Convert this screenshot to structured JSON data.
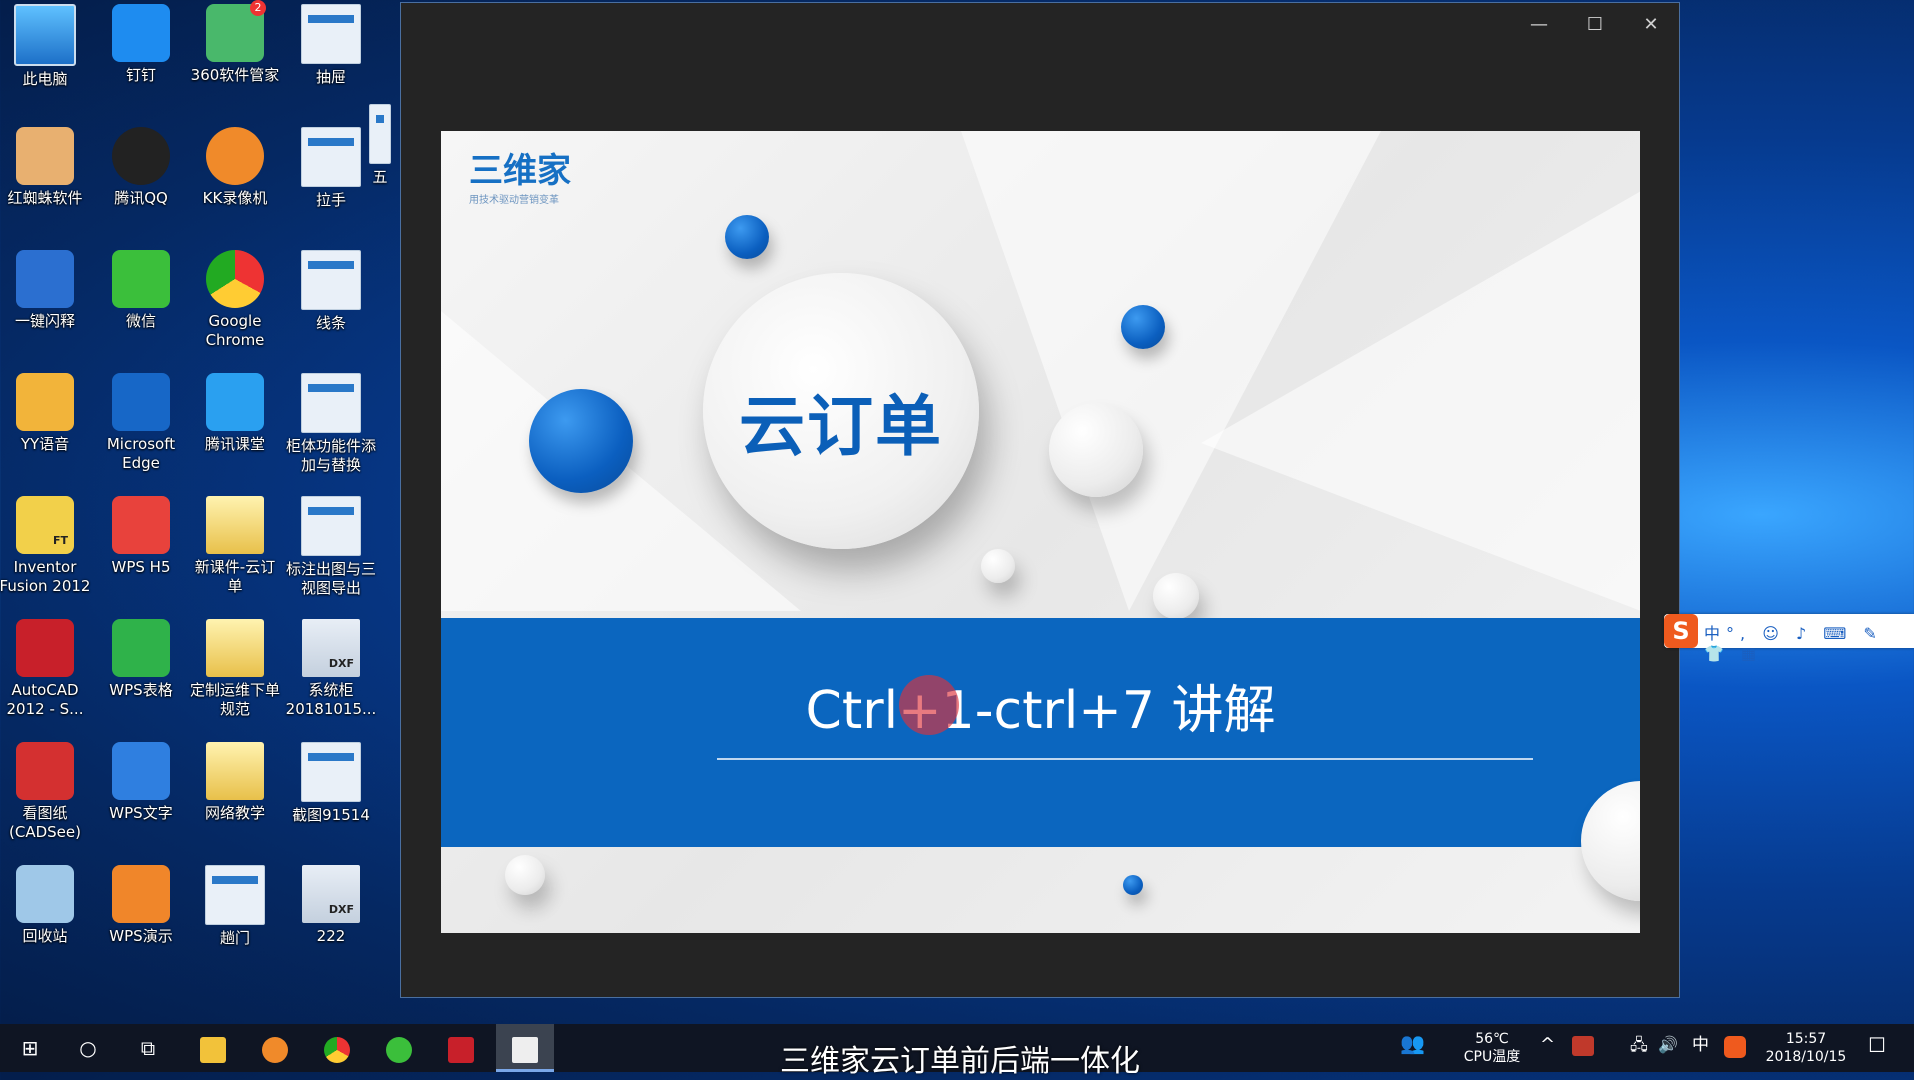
{
  "desktop": {
    "icons": [
      {
        "label": "此电脑",
        "icon": "computer-icon"
      },
      {
        "label": "钉钉",
        "icon": "dingtalk-icon"
      },
      {
        "label": "360软件管家",
        "icon": "360-software-icon",
        "badge": "2"
      },
      {
        "label": "抽屉",
        "icon": "thumbnail-icon"
      },
      {
        "label": "红蜘蛛软件",
        "icon": "red-spider-icon"
      },
      {
        "label": "腾讯QQ",
        "icon": "qq-penguin-icon"
      },
      {
        "label": "KK录像机",
        "icon": "kk-recorder-icon"
      },
      {
        "label": "拉手",
        "icon": "thumbnail-icon"
      },
      {
        "label": "一键闪释",
        "icon": "lightning-icon"
      },
      {
        "label": "微信",
        "icon": "wechat-icon"
      },
      {
        "label": "Google Chrome",
        "icon": "chrome-icon"
      },
      {
        "label": "线条",
        "icon": "thumbnail-icon"
      },
      {
        "label": "YY语音",
        "icon": "yy-raccoon-icon"
      },
      {
        "label": "Microsoft Edge",
        "icon": "edge-icon"
      },
      {
        "label": "腾讯课堂",
        "icon": "tencent-classroom-icon"
      },
      {
        "label": "柜体功能件添加与替换",
        "icon": "thumbnail-icon"
      },
      {
        "label": "Inventor Fusion 2012",
        "icon": "inventor-icon"
      },
      {
        "label": "WPS H5",
        "icon": "wps-h5-icon"
      },
      {
        "label": "新课件-云订单",
        "icon": "folder-icon"
      },
      {
        "label": "标注出图与三视图导出",
        "icon": "thumbnail-icon"
      },
      {
        "label": "AutoCAD 2012 - S...",
        "icon": "autocad-icon"
      },
      {
        "label": "WPS表格",
        "icon": "wps-sheet-icon"
      },
      {
        "label": "定制运维下单规范",
        "icon": "folder-icon"
      },
      {
        "label": "系统柜 20181015...",
        "icon": "dxf-file-icon"
      },
      {
        "label": "看图纸 (CADSee)",
        "icon": "cadsee-icon"
      },
      {
        "label": "WPS文字",
        "icon": "wps-writer-icon"
      },
      {
        "label": "网络教学",
        "icon": "folder-icon"
      },
      {
        "label": "截图91514",
        "icon": "thumbnail-icon"
      },
      {
        "label": "回收站",
        "icon": "recycle-bin-icon"
      },
      {
        "label": "WPS演示",
        "icon": "wps-presentation-icon"
      },
      {
        "label": "趟门",
        "icon": "thumbnail-icon"
      },
      {
        "label": "222",
        "icon": "dxf-file-icon"
      }
    ],
    "partial_label": "五",
    "dxf_tag": "DXF",
    "ft_tag": "FT"
  },
  "viewer": {
    "controls": {
      "minimize": "—",
      "maximize": "☐",
      "close": "✕"
    },
    "slide": {
      "logo_text": "三维家",
      "logo_tagline": "用技术驱动营销变革",
      "main_title": "云订单",
      "band_text": "Ctrl+1-ctrl+7 讲解"
    }
  },
  "ime": {
    "logo": "S",
    "mode": "中",
    "items": "°, ☺ ♪ ⌨ ✎ 👕 ▦"
  },
  "taskbar": {
    "caption": "三维家云订单前后端一体化",
    "start": "⊞",
    "search": "○",
    "taskview": "⧉",
    "temp": "56℃",
    "temp_label": "CPU温度",
    "chevron": "^",
    "ime_lang": "中",
    "time": "15:57",
    "date": "2018/10/15",
    "notify": "☐",
    "volume": "🔊",
    "network": "🖧",
    "people": "👥"
  }
}
